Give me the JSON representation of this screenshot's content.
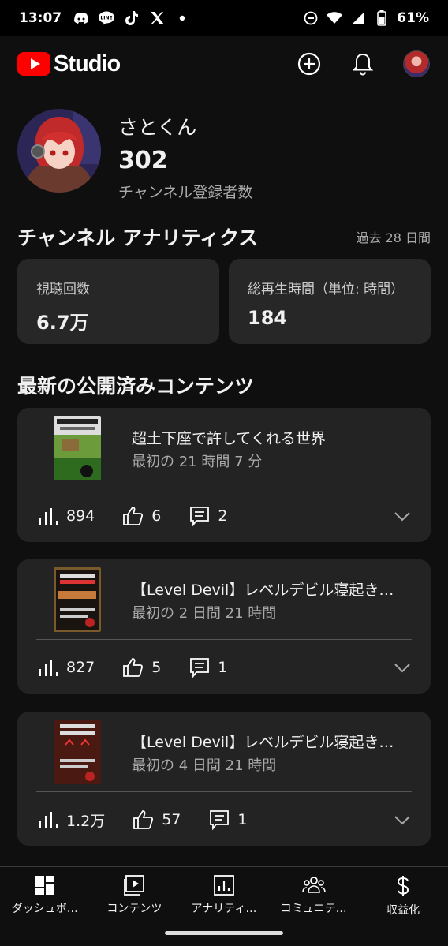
{
  "status_bar": {
    "time": "13:07",
    "battery_percent": "61%",
    "icons_left": [
      "discord-icon",
      "line-icon",
      "tiktok-icon",
      "x-icon",
      "dot-icon"
    ],
    "icons_right": [
      "dnd-icon",
      "wifi-icon",
      "signal-icon",
      "battery-icon"
    ]
  },
  "header": {
    "logo_text": "Studio",
    "brand_color": "#ff0000"
  },
  "channel": {
    "name": "さとくん",
    "subscriber_count": "302",
    "subscriber_label": "チャンネル登録者数"
  },
  "analytics": {
    "title": "チャンネル アナリティクス",
    "period": "過去 28 日間",
    "cards": [
      {
        "label": "視聴回数",
        "value": "6.7万"
      },
      {
        "label": "総再生時間（単位: 時間）",
        "value": "184"
      }
    ]
  },
  "latest": {
    "title": "最新の公開済みコンテンツ",
    "items": [
      {
        "title": "超土下座で許してくれる世界",
        "subtitle": "最初の 21 時間 7 分",
        "views": "894",
        "likes": "6",
        "comments": "2"
      },
      {
        "title": "【Level Devil】レベルデビル寝起きで…",
        "subtitle": "最初の 2 日間 21 時間",
        "views": "827",
        "likes": "5",
        "comments": "1"
      },
      {
        "title": "【Level Devil】レベルデビル寝起きで…",
        "subtitle": "最初の 4 日間 21 時間",
        "views": "1.2万",
        "likes": "57",
        "comments": "1"
      }
    ]
  },
  "bottom_nav": [
    {
      "label": "ダッシュボ…",
      "icon": "dashboard-icon"
    },
    {
      "label": "コンテンツ",
      "icon": "content-icon"
    },
    {
      "label": "アナリティ…",
      "icon": "analytics-icon"
    },
    {
      "label": "コミュニテ…",
      "icon": "community-icon"
    },
    {
      "label": "収益化",
      "icon": "earn-icon"
    }
  ]
}
